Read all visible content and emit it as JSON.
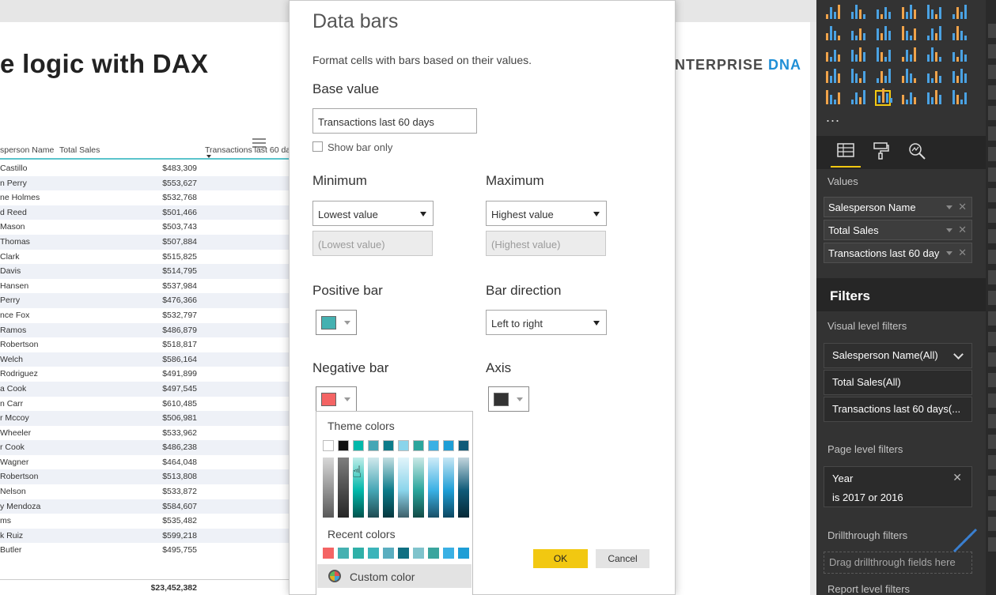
{
  "report": {
    "title": "e logic with DAX",
    "logo_main": "NTERPRISE",
    "logo_accent": "DNA",
    "table": {
      "col_name": "sperson Name",
      "col_sales": "Total Sales",
      "col_tx": "Transactions last 60 da",
      "rows": [
        {
          "name": "Castillo",
          "sales": "$483,309"
        },
        {
          "name": "n Perry",
          "sales": "$553,627"
        },
        {
          "name": "ne Holmes",
          "sales": "$532,768"
        },
        {
          "name": "d Reed",
          "sales": "$501,466"
        },
        {
          "name": "Mason",
          "sales": "$503,743"
        },
        {
          "name": "Thomas",
          "sales": "$507,884"
        },
        {
          "name": "Clark",
          "sales": "$515,825"
        },
        {
          "name": "Davis",
          "sales": "$514,795"
        },
        {
          "name": "Hansen",
          "sales": "$537,984"
        },
        {
          "name": "Perry",
          "sales": "$476,366"
        },
        {
          "name": "nce Fox",
          "sales": "$532,797"
        },
        {
          "name": "Ramos",
          "sales": "$486,879"
        },
        {
          "name": "Robertson",
          "sales": "$518,817"
        },
        {
          "name": "Welch",
          "sales": "$586,164"
        },
        {
          "name": "Rodriguez",
          "sales": "$491,899"
        },
        {
          "name": "a Cook",
          "sales": "$497,545"
        },
        {
          "name": "n Carr",
          "sales": "$610,485"
        },
        {
          "name": "r Mccoy",
          "sales": "$506,981"
        },
        {
          "name": "Wheeler",
          "sales": "$533,962"
        },
        {
          "name": "r Cook",
          "sales": "$486,238"
        },
        {
          "name": "Wagner",
          "sales": "$464,048"
        },
        {
          "name": "Robertson",
          "sales": "$513,808"
        },
        {
          "name": "Nelson",
          "sales": "$533,872"
        },
        {
          "name": "y Mendoza",
          "sales": "$584,607"
        },
        {
          "name": "ms",
          "sales": "$535,482"
        },
        {
          "name": "k Ruiz",
          "sales": "$599,218"
        },
        {
          "name": "Butler",
          "sales": "$495,755"
        }
      ],
      "total": "$23,452,382"
    }
  },
  "dialog": {
    "title": "Data bars",
    "description": "Format cells with bars based on their values.",
    "base_value_label": "Base value",
    "base_value": "Transactions last 60 days",
    "show_bar_only": "Show bar only",
    "minimum_label": "Minimum",
    "minimum_value": "Lowest value",
    "minimum_placeholder": "(Lowest value)",
    "maximum_label": "Maximum",
    "maximum_value": "Highest value",
    "maximum_placeholder": "(Highest value)",
    "positive_bar_label": "Positive bar",
    "positive_bar_color": "#45b1b1",
    "bar_direction_label": "Bar direction",
    "bar_direction_value": "Left to right",
    "negative_bar_label": "Negative bar",
    "negative_bar_color": "#f46464",
    "axis_label": "Axis",
    "axis_color": "#333333",
    "palette": {
      "theme_label": "Theme colors",
      "theme_colors": [
        "#ffffff",
        "#111111",
        "#01b8aa",
        "#45a6b5",
        "#0c7b8a",
        "#8ad4eb",
        "#2aa59c",
        "#3ab0e4",
        "#1e9ed6",
        "#0f5a78"
      ],
      "recent_label": "Recent colors",
      "recent_colors": [
        "#f46464",
        "#45b1b1",
        "#2fb0a8",
        "#3bb4ba",
        "#5aaec0",
        "#0f6f82",
        "#7fc3cc",
        "#3aa59e",
        "#3ab0e4",
        "#1e9ed6"
      ],
      "custom_label": "Custom color"
    },
    "ok_label": "OK",
    "cancel_label": "Cancel"
  },
  "pane": {
    "values_label": "Values",
    "fields": [
      "Salesperson Name",
      "Total Sales",
      "Transactions last 60 day"
    ],
    "filters_title": "Filters",
    "visual_level_label": "Visual level filters",
    "visual_filters": [
      "Salesperson Name(All)",
      "Total Sales(All)",
      "Transactions last 60 days(..."
    ],
    "page_level_label": "Page level filters",
    "page_filter_field": "Year",
    "page_filter_value": "is 2017 or 2016",
    "drillthrough_label": "Drillthrough filters",
    "drillthrough_placeholder": "Drag drillthrough fields here",
    "report_level_label": "Report level filters",
    "more": "..."
  }
}
